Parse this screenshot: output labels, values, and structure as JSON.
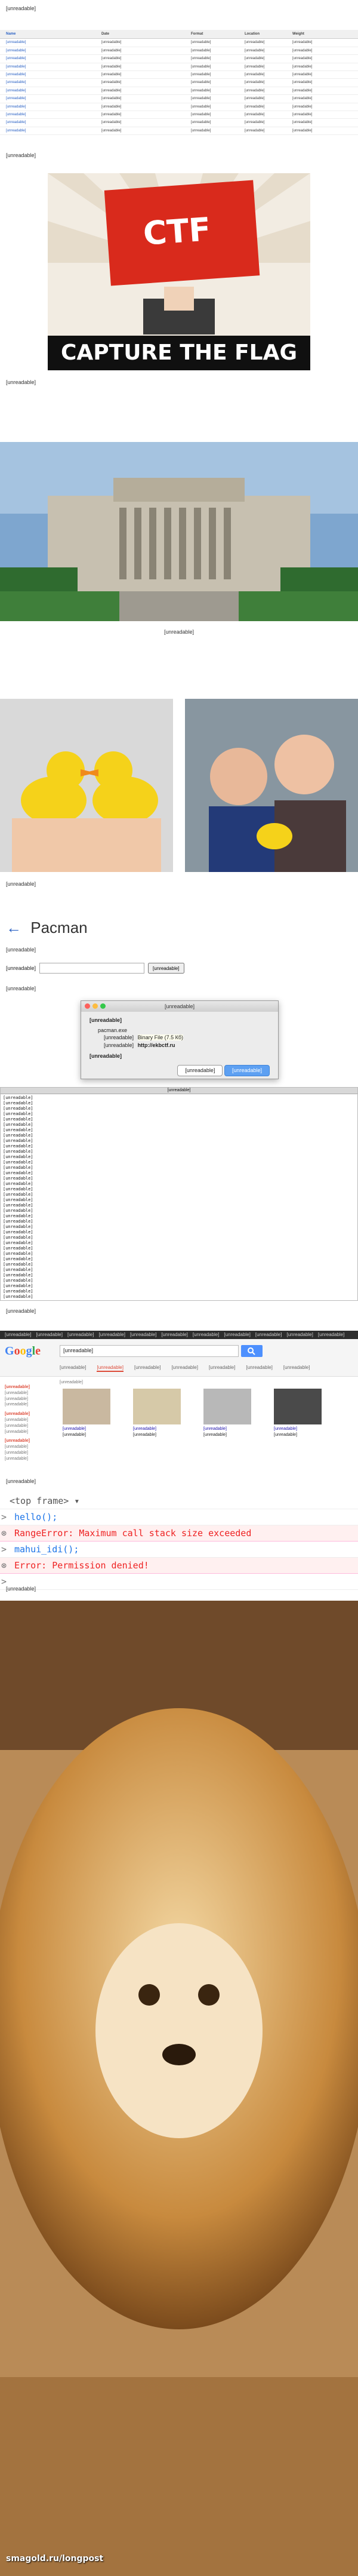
{
  "intro": {
    "paragraph": "[unreadable]"
  },
  "schedule": {
    "headers": [
      "Name",
      "Date",
      "Format",
      "Location",
      "Weight"
    ],
    "rows": [
      [
        "[unreadable]",
        "[unreadable]",
        "[unreadable]",
        "[unreadable]",
        "[unreadable]"
      ],
      [
        "[unreadable]",
        "[unreadable]",
        "[unreadable]",
        "[unreadable]",
        "[unreadable]"
      ],
      [
        "[unreadable]",
        "[unreadable]",
        "[unreadable]",
        "[unreadable]",
        "[unreadable]"
      ],
      [
        "[unreadable]",
        "[unreadable]",
        "[unreadable]",
        "[unreadable]",
        "[unreadable]"
      ],
      [
        "[unreadable]",
        "[unreadable]",
        "[unreadable]",
        "[unreadable]",
        "[unreadable]"
      ],
      [
        "[unreadable]",
        "[unreadable]",
        "[unreadable]",
        "[unreadable]",
        "[unreadable]"
      ],
      [
        "[unreadable]",
        "[unreadable]",
        "[unreadable]",
        "[unreadable]",
        "[unreadable]"
      ],
      [
        "[unreadable]",
        "[unreadable]",
        "[unreadable]",
        "[unreadable]",
        "[unreadable]"
      ],
      [
        "[unreadable]",
        "[unreadable]",
        "[unreadable]",
        "[unreadable]",
        "[unreadable]"
      ],
      [
        "[unreadable]",
        "[unreadable]",
        "[unreadable]",
        "[unreadable]",
        "[unreadable]"
      ],
      [
        "[unreadable]",
        "[unreadable]",
        "[unreadable]",
        "[unreadable]",
        "[unreadable]"
      ],
      [
        "[unreadable]",
        "[unreadable]",
        "[unreadable]",
        "[unreadable]",
        "[unreadable]"
      ]
    ]
  },
  "after_table": "[unreadable]",
  "poster": {
    "flag_text": "CTF",
    "banner_text": "CAPTURE THE FLAG",
    "colors": {
      "red": "#d92a1c",
      "black": "#101010",
      "cream": "#f2ece2"
    }
  },
  "ctf_explanation": "[unreadable]",
  "building_caption": "[unreadable]",
  "ducks_caption": "[unreadable]",
  "pacman": {
    "title": "Pacman",
    "instruction": "[unreadable]",
    "answer_label": "[unreadable]",
    "input_value": "",
    "submit_label": "[unreadable]"
  },
  "download_intro": "[unreadable]",
  "dialog": {
    "title": "[unreadable]",
    "question": "[unreadable]",
    "filename": "pacman.exe",
    "type_label": "[unreadable]",
    "type_value": "Binary File (7.5 Кб)",
    "from_label": "[unreadable]",
    "from_value": "http://ekbctf.ru",
    "save_question": "[unreadable]",
    "cancel_label": "[unreadable]",
    "save_label": "[unreadable]"
  },
  "terminal": {
    "title": "[unreadable]",
    "lines": [
      "[unreadable]",
      "[unreadable]",
      "[unreadable]",
      "[unreadable]",
      "[unreadable]",
      "[unreadable]",
      "[unreadable]",
      "[unreadable]",
      "[unreadable]",
      "[unreadable]",
      "[unreadable]",
      "[unreadable]",
      "[unreadable]",
      "[unreadable]",
      "[unreadable]",
      "[unreadable]",
      "[unreadable]",
      "[unreadable]",
      "[unreadable]",
      "[unreadable]",
      "[unreadable]",
      "[unreadable]",
      "[unreadable]",
      "[unreadable]",
      "[unreadable]",
      "[unreadable]",
      "[unreadable]",
      "[unreadable]",
      "[unreadable]",
      "[unreadable]",
      "[unreadable]",
      "[unreadable]",
      "[unreadable]",
      "[unreadable]",
      "[unreadable]",
      "[unreadable]",
      "[unreadable]",
      "[unreadable]"
    ]
  },
  "after_terminal": "[unreadable]",
  "google": {
    "top_links": [
      "[unreadable]",
      "[unreadable]",
      "[unreadable]",
      "[unreadable]",
      "[unreadable]",
      "[unreadable]",
      "[unreadable]",
      "[unreadable]",
      "[unreadable]",
      "[unreadable]",
      "[unreadable]"
    ],
    "logo": "Google",
    "query": "[unreadable]",
    "tabs": [
      "[unreadable]",
      "[unreadable]",
      "[unreadable]",
      "[unreadable]",
      "[unreadable]",
      "[unreadable]",
      "[unreadable]"
    ],
    "result_count": "[unreadable]",
    "left_headings": [
      "[unreadable]",
      "[unreadable]",
      "[unreadable]"
    ],
    "left_items": [
      "[unreadable]",
      "[unreadable]",
      "[unreadable]",
      "[unreadable]",
      "[unreadable]",
      "[unreadable]",
      "[unreadable]",
      "[unreadable]",
      "[unreadable]"
    ],
    "results": [
      {
        "site": "[unreadable]",
        "caption": "[unreadable]"
      },
      {
        "site": "[unreadable]",
        "caption": "[unreadable]"
      },
      {
        "site": "[unreadable]",
        "caption": "[unreadable]"
      },
      {
        "site": "[unreadable]",
        "caption": "[unreadable]"
      }
    ]
  },
  "after_google": "[unreadable]",
  "console": {
    "frame": "<top frame>",
    "lines": [
      {
        "kind": "in",
        "text": "hello();"
      },
      {
        "kind": "err",
        "text": "RangeError: Maximum call stack size exceeded"
      },
      {
        "kind": "in",
        "text": "mahui_idi();"
      },
      {
        "kind": "err",
        "text": "Error: Permission denied!"
      },
      {
        "kind": "prompt",
        "text": ""
      }
    ]
  },
  "after_console": "[unreadable]",
  "footer": {
    "watermark": "smagold.ru/longpost"
  }
}
